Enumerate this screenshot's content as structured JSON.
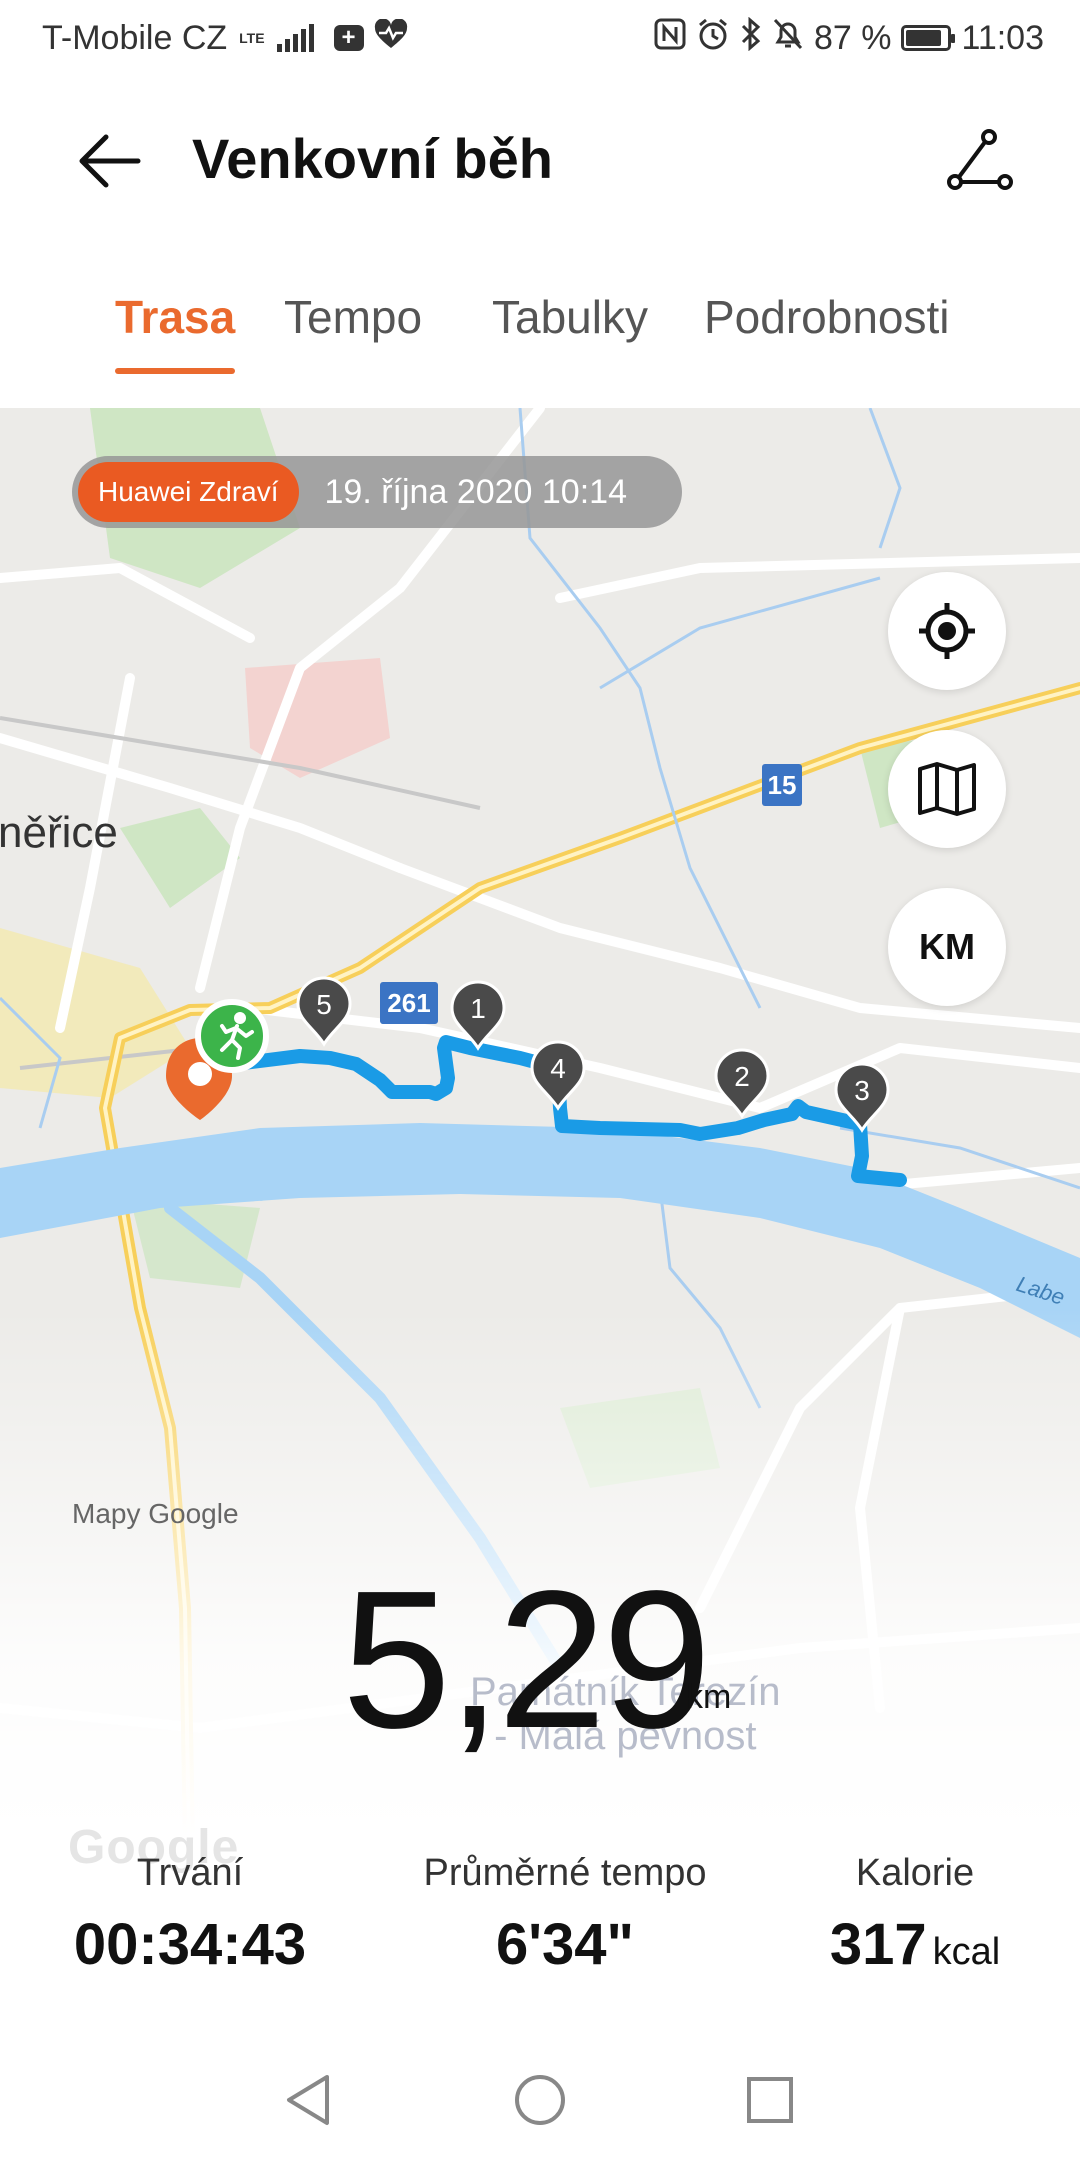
{
  "status_bar": {
    "carrier": "T-Mobile CZ",
    "network": "LTE",
    "battery": "87 %",
    "battery_level": 0.87,
    "time": "11:03",
    "icons": [
      "signal-icon",
      "plus-notification-icon",
      "heart-notification-icon",
      "nfc-icon",
      "alarm-icon",
      "bluetooth-icon",
      "mute-icon",
      "battery-icon"
    ]
  },
  "header": {
    "title": "Venkovní běh",
    "back_icon": "arrow-left-icon",
    "route_icon": "route-share-icon"
  },
  "tabs": [
    {
      "label": "Trasa",
      "active": true
    },
    {
      "label": "Tempo",
      "active": false
    },
    {
      "label": "Tabulky",
      "active": false
    },
    {
      "label": "Podrobnosti",
      "active": false
    }
  ],
  "map": {
    "source_badge": "Huawei Zdraví",
    "date": "19. října 2020 10:14",
    "controls": {
      "locate_icon": "crosshair-icon",
      "layers_icon": "map-icon",
      "km_label": "KM"
    },
    "city_label": "něřice",
    "poi_label_line1": "Památník Terezín",
    "poi_label_line2": "- Malá pevnost",
    "river_label": "Labe",
    "road_shields": [
      "15",
      "261"
    ],
    "km_markers": [
      "1",
      "2",
      "3",
      "4",
      "5"
    ],
    "attribution": "Mapy Google",
    "watermark": "Google",
    "route_color": "#1a9be6",
    "start_marker_color": "#3cb44a",
    "end_marker_color": "#ea6a2e"
  },
  "summary": {
    "distance_value": "5,29",
    "distance_unit": "km"
  },
  "stats": {
    "duration": {
      "label": "Trvání",
      "value": "00:34:43"
    },
    "pace": {
      "label": "Průměrné tempo",
      "value": "6'34\""
    },
    "calories": {
      "label": "Kalorie",
      "value": "317",
      "unit": "kcal"
    }
  },
  "colors": {
    "accent": "#ea6a2e",
    "route": "#1a9be6"
  }
}
